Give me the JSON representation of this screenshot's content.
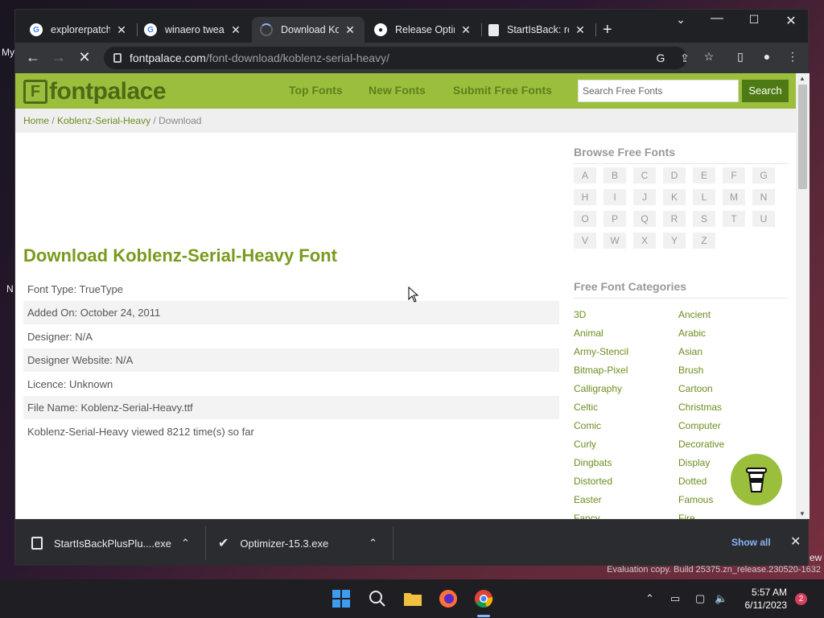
{
  "browser": {
    "tabs": [
      {
        "title": "explorerpatche",
        "icon": "google-icon"
      },
      {
        "title": "winaero tweak",
        "icon": "google-icon"
      },
      {
        "title": "Download Kob",
        "icon": "loading-icon",
        "active": true
      },
      {
        "title": "Release Optim",
        "icon": "github-icon"
      },
      {
        "title": "StartIsBack: re",
        "icon": "page-icon"
      }
    ],
    "url_host": "fontpalace.com",
    "url_path": "/font-download/koblenz-serial-heavy/"
  },
  "site": {
    "logo_text": "fontpalace",
    "nav": [
      "Top Fonts",
      "New Fonts",
      "Submit Free Fonts"
    ],
    "search_placeholder": "Search Free Fonts",
    "search_button": "Search",
    "breadcrumb": {
      "home": "Home",
      "sep1": " / ",
      "font": "Koblenz-Serial-Heavy",
      "sep2": " / ",
      "current": "Download"
    }
  },
  "main": {
    "title": "Download Koblenz-Serial-Heavy Font",
    "info": [
      "Font Type: TrueType",
      "Added On: October 24, 2011",
      "Designer: N/A",
      "Designer Website: N/A",
      "Licence: Unknown",
      "File Name: Koblenz-Serial-Heavy.ttf",
      "Koblenz-Serial-Heavy viewed 8212 time(s) so far"
    ]
  },
  "sidebar": {
    "browse_heading": "Browse Free Fonts",
    "letters": [
      "A",
      "B",
      "C",
      "D",
      "E",
      "F",
      "G",
      "H",
      "I",
      "J",
      "K",
      "L",
      "M",
      "N",
      "O",
      "P",
      "Q",
      "R",
      "S",
      "T",
      "U",
      "V",
      "W",
      "X",
      "Y",
      "Z"
    ],
    "categories_heading": "Free Font Categories",
    "categories_left": [
      "3D",
      "Animal",
      "Army-Stencil",
      "Bitmap-Pixel",
      "Calligraphy",
      "Celtic",
      "Comic",
      "Curly",
      "Dingbats",
      "Distorted",
      "Easter",
      "Fancy"
    ],
    "categories_right": [
      "Ancient",
      "Arabic",
      "Asian",
      "Brush",
      "Cartoon",
      "Christmas",
      "Computer",
      "Decorative",
      "Display",
      "Dotted",
      "Famous",
      "Fire"
    ]
  },
  "downloads": {
    "items": [
      "StartIsBackPlusPlu....exe",
      "Optimizer-15.3.exe"
    ],
    "show_all": "Show all"
  },
  "taskbar": {
    "time": "5:57 AM",
    "date": "6/11/2023",
    "notifications": "2"
  },
  "desktop": {
    "watermark": "Evaluation copy. Build 25375.zn_release.230520-1632",
    "frag_my": "My",
    "frag_n": "N",
    "frag_ew": "ew"
  },
  "colors": {
    "brand_green": "#9bbf3d",
    "link_green": "#6b8d1e",
    "title_green": "#7a9a1e"
  }
}
